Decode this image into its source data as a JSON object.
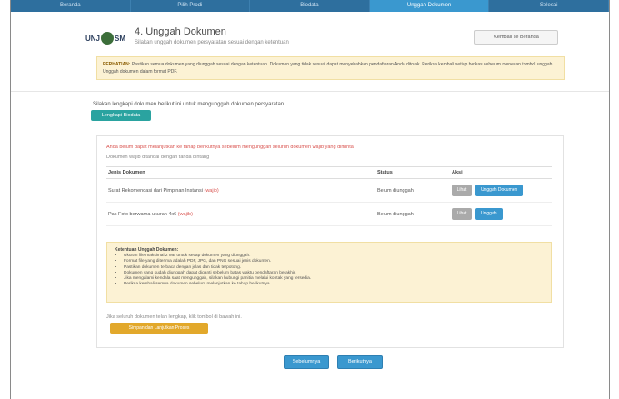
{
  "nav": {
    "steps": [
      "Beranda",
      "Pilih Prodi",
      "Biodata",
      "Unggah Dokumen",
      "Selesai"
    ],
    "active_index": 3
  },
  "header": {
    "logo_text_left": "UNJ",
    "logo_text_right": "SM",
    "title": "4. Unggah Dokumen",
    "subtitle": "Silakan unggah dokumen persyaratan sesuai dengan ketentuan",
    "back_button": "Kembali ke Beranda"
  },
  "note": {
    "label": "PERHATIAN:",
    "text": "Pastikan semua dokumen yang diunggah sesuai dengan ketentuan. Dokumen yang tidak sesuai dapat menyebabkan pendaftaran Anda ditolak. Periksa kembali setiap berkas sebelum menekan tombol unggah. Unggah dokumen dalam format PDF."
  },
  "intro": {
    "text": "Silakan lengkapi dokumen berikut ini untuk mengunggah dokumen persyaratan.",
    "button": "Lengkapi Biodata"
  },
  "card": {
    "warning": "Anda belum dapat melanjutkan ke tahap berikutnya sebelum mengunggah seluruh dokumen wajib yang diminta.",
    "sub": "Dokumen wajib ditandai dengan tanda bintang",
    "columns": [
      "Jenis Dokumen",
      "Status",
      "Aksi"
    ],
    "rows": [
      {
        "doc": "Surat Rekomendasi dari Pimpinan Instansi",
        "req": "(wajib)",
        "status": "Belum diunggah",
        "btn1": "Lihat",
        "btn2": "Unggah Dokumen"
      },
      {
        "doc": "Pas Foto berwarna ukuran 4x6",
        "req": "(wajib)",
        "status": "Belum diunggah",
        "btn1": "Lihat",
        "btn2": "Unggah"
      }
    ],
    "notice_title": "Ketentuan Unggah Dokumen:",
    "notice_items": [
      "Ukuran file maksimal 2 MB untuk setiap dokumen yang diunggah.",
      "Format file yang diterima adalah PDF, JPG, dan PNG sesuai jenis dokumen.",
      "Pastikan dokumen terbaca dengan jelas dan tidak terpotong.",
      "Dokumen yang sudah diunggah dapat diganti sebelum batas waktu pendaftaran berakhir.",
      "Jika mengalami kendala saat mengunggah, silakan hubungi panitia melalui kontak yang tersedia.",
      "Periksa kembali semua dokumen sebelum melanjutkan ke tahap berikutnya."
    ],
    "footline": "Jika seluruh dokumen telah lengkap, klik tombol di bawah ini.",
    "yellow_button": "Simpan dan Lanjutkan Proses"
  },
  "bottom": {
    "prev": "Sebelumnya",
    "next": "Berikutnya"
  }
}
